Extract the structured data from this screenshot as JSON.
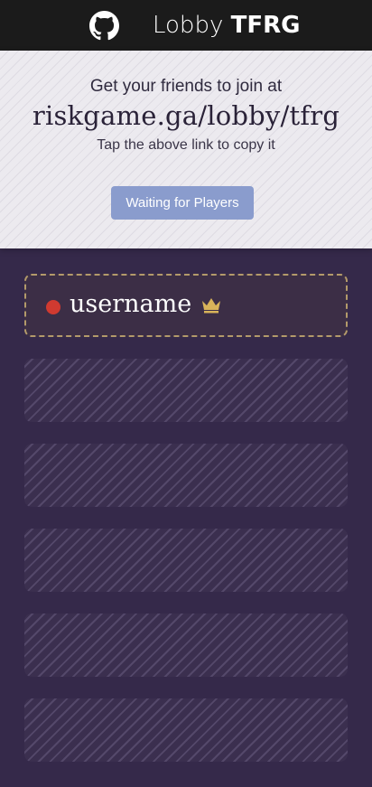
{
  "header": {
    "title_prefix": "Lobby",
    "lobby_code": "TFRG",
    "github_icon": "github-icon"
  },
  "invite": {
    "prompt": "Get your friends to join at",
    "link": "riskgame.ga/lobby/tfrg",
    "hint": "Tap the above link to copy it",
    "status_button": "Waiting for Players"
  },
  "players": [
    {
      "name": "username",
      "color": "#d03a30",
      "is_host": true,
      "host_icon": "crown-icon"
    }
  ],
  "empty_slots": 5,
  "colors": {
    "accent": "#8a9ccd",
    "background": "#35294a",
    "host_crown": "#d8b35a",
    "player_dot": "#d03a30"
  }
}
